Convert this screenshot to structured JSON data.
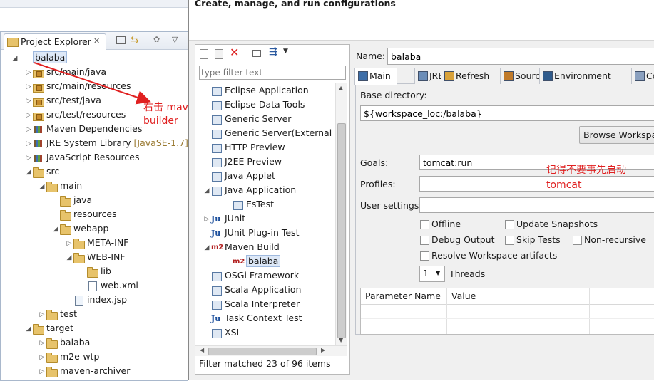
{
  "top_banner": "Create, manage, and run configurations",
  "explorer": {
    "title": "Project Explorer",
    "close_glyph": "✕",
    "items": [
      {
        "label": "balaba",
        "type": "project",
        "indent": 0,
        "expanded": true,
        "selected": true
      },
      {
        "label": "src/main/java",
        "type": "pkgfolder",
        "indent": 1,
        "expanded": false
      },
      {
        "label": "src/main/resources",
        "type": "pkgfolder",
        "indent": 1,
        "expanded": false
      },
      {
        "label": "src/test/java",
        "type": "pkgfolder",
        "indent": 1,
        "expanded": false
      },
      {
        "label": "src/test/resources",
        "type": "pkgfolder",
        "indent": 1,
        "expanded": false
      },
      {
        "label": "Maven Dependencies",
        "type": "lib",
        "indent": 1,
        "expanded": false
      },
      {
        "label": "JRE System Library",
        "suffix": "[JavaSE-1.7]",
        "type": "lib",
        "indent": 1,
        "expanded": false
      },
      {
        "label": "JavaScript Resources",
        "type": "lib",
        "indent": 1,
        "expanded": false
      },
      {
        "label": "src",
        "type": "folder",
        "indent": 1,
        "expanded": true
      },
      {
        "label": "main",
        "type": "folder",
        "indent": 2,
        "expanded": true
      },
      {
        "label": "java",
        "type": "folder",
        "indent": 3,
        "expanded": null
      },
      {
        "label": "resources",
        "type": "folder",
        "indent": 3,
        "expanded": null
      },
      {
        "label": "webapp",
        "type": "folder",
        "indent": 3,
        "expanded": true
      },
      {
        "label": "META-INF",
        "type": "folder",
        "indent": 4,
        "expanded": false
      },
      {
        "label": "WEB-INF",
        "type": "folder",
        "indent": 4,
        "expanded": true
      },
      {
        "label": "lib",
        "type": "folder",
        "indent": 5,
        "expanded": null
      },
      {
        "label": "web.xml",
        "type": "file",
        "indent": 5,
        "expanded": null
      },
      {
        "label": "index.jsp",
        "type": "jsp",
        "indent": 4,
        "expanded": null
      },
      {
        "label": "test",
        "type": "folder",
        "indent": 2,
        "expanded": false
      },
      {
        "label": "target",
        "type": "folder",
        "indent": 1,
        "expanded": true
      },
      {
        "label": "balaba",
        "type": "folder",
        "indent": 2,
        "expanded": false
      },
      {
        "label": "m2e-wtp",
        "type": "folder",
        "indent": 2,
        "expanded": false
      },
      {
        "label": "maven-archiver",
        "type": "folder",
        "indent": 2,
        "expanded": false
      }
    ]
  },
  "annotations": {
    "right_click": "右击 maven\nbuilder",
    "no_start": "记得不要事先启动\ntomcat",
    "red": "#e02020"
  },
  "configs": {
    "filter_placeholder": "type filter text",
    "items": [
      {
        "label": "Eclipse Application",
        "icon": "cfg",
        "indent": 1,
        "twisty": ""
      },
      {
        "label": "Eclipse Data Tools",
        "icon": "cfg",
        "indent": 1,
        "twisty": ""
      },
      {
        "label": "Generic Server",
        "icon": "cfg",
        "indent": 1,
        "twisty": ""
      },
      {
        "label": "Generic Server(External L",
        "icon": "cfg",
        "indent": 1,
        "twisty": ""
      },
      {
        "label": "HTTP Preview",
        "icon": "cfg",
        "indent": 1,
        "twisty": ""
      },
      {
        "label": "J2EE Preview",
        "icon": "cfg",
        "indent": 1,
        "twisty": ""
      },
      {
        "label": "Java Applet",
        "icon": "cfg",
        "indent": 1,
        "twisty": ""
      },
      {
        "label": "Java Application",
        "icon": "cfg",
        "indent": 1,
        "twisty": "◢"
      },
      {
        "label": "EsTest",
        "icon": "cfg",
        "indent": 2,
        "twisty": ""
      },
      {
        "label": "JUnit",
        "icon": "ju",
        "indent": 1,
        "twisty": "▷"
      },
      {
        "label": "JUnit Plug-in Test",
        "icon": "ju",
        "indent": 1,
        "twisty": ""
      },
      {
        "label": "Maven Build",
        "icon": "m2",
        "indent": 1,
        "twisty": "◢"
      },
      {
        "label": "balaba",
        "icon": "m2",
        "indent": 2,
        "twisty": "",
        "selected": true
      },
      {
        "label": "OSGi Framework",
        "icon": "cfg",
        "indent": 1,
        "twisty": ""
      },
      {
        "label": "Scala Application",
        "icon": "cfg",
        "indent": 1,
        "twisty": ""
      },
      {
        "label": "Scala Interpreter",
        "icon": "cfg",
        "indent": 1,
        "twisty": ""
      },
      {
        "label": "Task Context Test",
        "icon": "ju",
        "indent": 1,
        "twisty": ""
      },
      {
        "label": "XSL",
        "icon": "cfg",
        "indent": 1,
        "twisty": ""
      }
    ],
    "status": "Filter matched 23 of 96 items"
  },
  "editor": {
    "name_label": "Name:",
    "name_value": "balaba",
    "tabs": [
      "Main",
      "JRE",
      "Refresh",
      "Source",
      "Environment",
      "Comm"
    ],
    "base_dir_label": "Base directory:",
    "base_dir_value": "${workspace_loc:/balaba}",
    "browse_workspace": "Browse Workspac",
    "goals_label": "Goals:",
    "goals_value": "tomcat:run",
    "profiles_label": "Profiles:",
    "profiles_value": "",
    "user_settings_label": "User settings:",
    "user_settings_value": "",
    "checks": {
      "offline": "Offline",
      "update_snapshots": "Update Snapshots",
      "debug_output": "Debug Output",
      "skip_tests": "Skip Tests",
      "non_recursive": "Non-recursive",
      "resolve_workspace": "Resolve Workspace artifacts"
    },
    "threads_value": "1",
    "threads_label": "Threads",
    "param_table": {
      "headers": [
        "Parameter Name",
        "Value"
      ]
    }
  }
}
